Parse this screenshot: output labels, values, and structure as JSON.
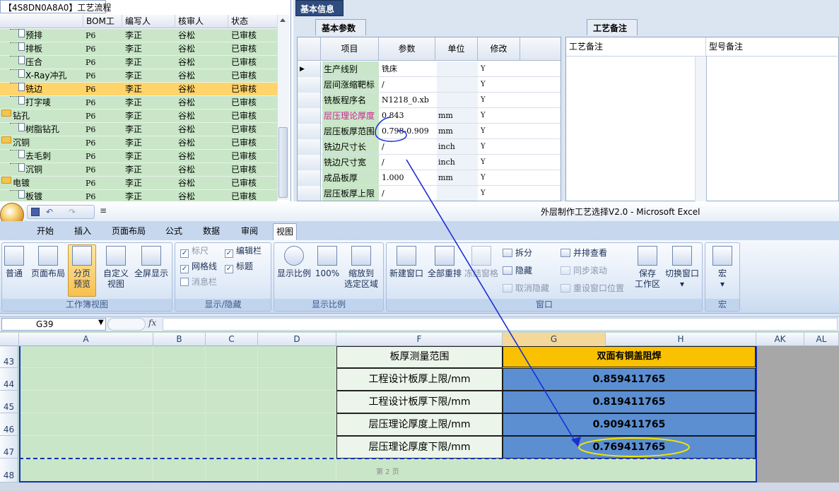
{
  "tree": {
    "title": "【4S8DN0A8A0】工艺流程",
    "headers": [
      "BOM工厂",
      "编写人",
      "核审人",
      "状态"
    ],
    "rows": [
      {
        "name": "预排",
        "bom": "P6",
        "writer": "李正",
        "reviewer": "谷松",
        "status": "已审核",
        "type": "leaf"
      },
      {
        "name": "排板",
        "bom": "P6",
        "writer": "李正",
        "reviewer": "谷松",
        "status": "已审核",
        "type": "leaf"
      },
      {
        "name": "压合",
        "bom": "P6",
        "writer": "李正",
        "reviewer": "谷松",
        "status": "已审核",
        "type": "leaf"
      },
      {
        "name": "X-Ray冲孔",
        "bom": "P6",
        "writer": "李正",
        "reviewer": "谷松",
        "status": "已审核",
        "type": "leaf"
      },
      {
        "name": "铣边",
        "bom": "P6",
        "writer": "李正",
        "reviewer": "谷松",
        "status": "已审核",
        "type": "leaf",
        "selected": true
      },
      {
        "name": "打字唛",
        "bom": "P6",
        "writer": "李正",
        "reviewer": "谷松",
        "status": "已审核",
        "type": "leaf"
      },
      {
        "name": "钻孔",
        "bom": "P6",
        "writer": "李正",
        "reviewer": "谷松",
        "status": "已审核",
        "type": "folder"
      },
      {
        "name": "树脂钻孔",
        "bom": "P6",
        "writer": "李正",
        "reviewer": "谷松",
        "status": "已审核",
        "type": "leaf"
      },
      {
        "name": "沉铜",
        "bom": "P6",
        "writer": "李正",
        "reviewer": "谷松",
        "status": "已审核",
        "type": "folder"
      },
      {
        "name": "去毛刺",
        "bom": "P6",
        "writer": "李正",
        "reviewer": "谷松",
        "status": "已审核",
        "type": "leaf"
      },
      {
        "name": "沉铜",
        "bom": "P6",
        "writer": "李正",
        "reviewer": "谷松",
        "status": "已审核",
        "type": "leaf"
      },
      {
        "name": "电镀",
        "bom": "P6",
        "writer": "李正",
        "reviewer": "谷松",
        "status": "已审核",
        "type": "folder"
      },
      {
        "name": "板镀",
        "bom": "P6",
        "writer": "李正",
        "reviewer": "谷松",
        "status": "已审核",
        "type": "leaf"
      }
    ]
  },
  "info": {
    "tab": "基本信息",
    "param_tab": "基本参数",
    "remark_tab": "工艺备注",
    "param_headers": [
      "项目",
      "参数",
      "单位",
      "修改"
    ],
    "remark_headers": [
      "工艺备注",
      "型号备注"
    ],
    "params": [
      {
        "name": "生产线别",
        "value": "铣床",
        "unit": "",
        "mod": "Y",
        "current": true
      },
      {
        "name": "层间涨缩靶标",
        "value": "/",
        "unit": "",
        "mod": "Y"
      },
      {
        "name": "铣板程序名",
        "value": "N1218_0.xb",
        "unit": "",
        "mod": "Y"
      },
      {
        "name": "层压理论厚度",
        "value": "0.843",
        "unit": "mm",
        "mod": "Y",
        "pink": true
      },
      {
        "name": "层压板厚范围",
        "value": "0.798-0.909",
        "unit": "mm",
        "mod": "Y"
      },
      {
        "name": "铣边尺寸长",
        "value": "/",
        "unit": "inch",
        "mod": "Y"
      },
      {
        "name": "铣边尺寸宽",
        "value": "/",
        "unit": "inch",
        "mod": "Y"
      },
      {
        "name": "成品板厚",
        "value": "1.000",
        "unit": "mm",
        "mod": "Y"
      },
      {
        "name": "层压板厚上限",
        "value": "/",
        "unit": "",
        "mod": "Y"
      }
    ]
  },
  "excel": {
    "title": "外层制作工艺选择V2.0 - Microsoft Excel",
    "tabs": [
      "开始",
      "插入",
      "页面布局",
      "公式",
      "数据",
      "审阅",
      "视图"
    ],
    "active_tab": "视图",
    "groups": {
      "workbook_views": "工作簿视图",
      "show_hide": "显示/隐藏",
      "zoom": "显示比例",
      "window": "窗口",
      "macro": "宏"
    },
    "buttons": {
      "normal": "普通",
      "page_layout": "页面布局",
      "page_break_1": "分页",
      "page_break_2": "预览",
      "custom_view_1": "自定义",
      "custom_view_2": "视图",
      "fullscreen": "全屏显示",
      "ruler": "标尺",
      "formula_bar": "编辑栏",
      "gridlines": "网格线",
      "headings": "标题",
      "message_bar": "消息栏",
      "zoom": "显示比例",
      "zoom_100": "100%",
      "zoom_sel_1": "缩放到",
      "zoom_sel_2": "选定区域",
      "new_window": "新建窗口",
      "arrange_all": "全部重排",
      "freeze": "冻结窗格",
      "split": "拆分",
      "hide": "隐藏",
      "unhide": "取消隐藏",
      "side_by_side": "并排查看",
      "sync_scroll": "同步滚动",
      "reset_pos": "重设窗口位置",
      "save_ws_1": "保存",
      "save_ws_2": "工作区",
      "switch_window": "切换窗口",
      "macros": "宏"
    },
    "name_box": "G39",
    "fx": "fx",
    "columns": [
      "A",
      "B",
      "C",
      "D",
      "F",
      "G",
      "H",
      "AK",
      "AL"
    ],
    "rows": [
      "43",
      "44",
      "45",
      "46",
      "47",
      "48"
    ],
    "header_label": "板厚测量范围",
    "header_value": "双面有铜盖阻焊",
    "data": [
      {
        "label": "工程设计板厚上限/mm",
        "value": "0.859411765"
      },
      {
        "label": "工程设计板厚下限/mm",
        "value": "0.819411765"
      },
      {
        "label": "层压理论厚度上限/mm",
        "value": "0.909411765"
      },
      {
        "label": "层压理论厚度下限/mm",
        "value": "0.769411765"
      }
    ],
    "page_mark": "第 2 页"
  },
  "colors": {
    "accent_blue": "#1230b5",
    "header_yellow": "#f9c100",
    "value_blue": "#5b8fd2",
    "green_fill": "#c9e6c8",
    "annotation_yellow": "#f2e600"
  }
}
